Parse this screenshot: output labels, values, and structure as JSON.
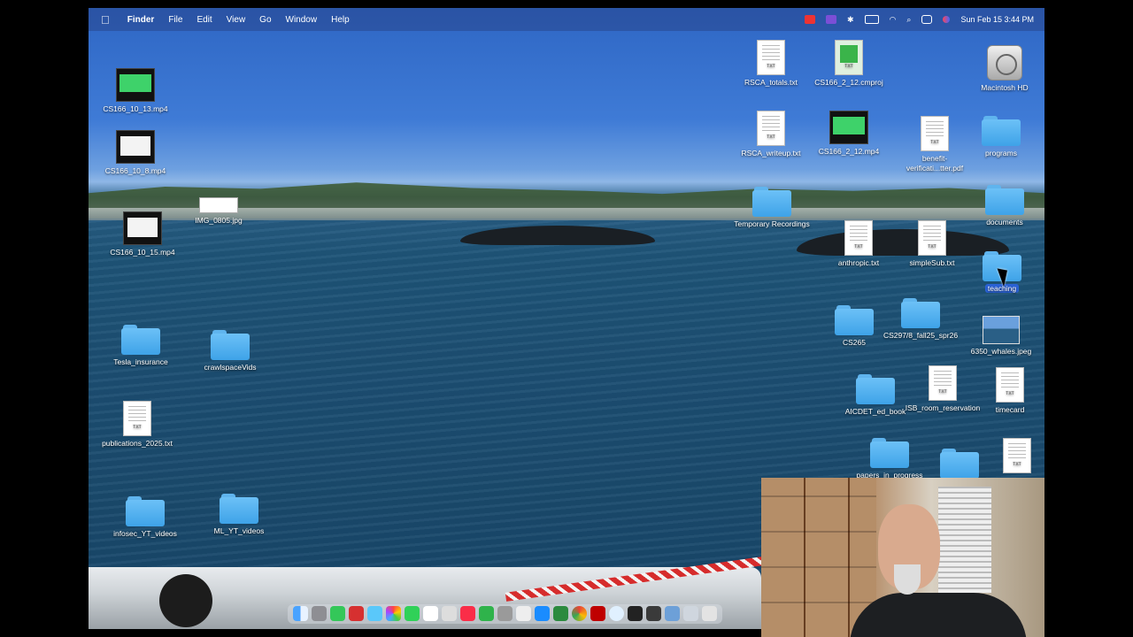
{
  "menubar": {
    "app": "Finder",
    "items": [
      "File",
      "Edit",
      "View",
      "Go",
      "Window",
      "Help"
    ],
    "clock": "Sun Feb 15  3:44 PM"
  },
  "desktop": {
    "items": [
      {
        "label": "CS166_10_13.mp4",
        "kind": "video-thumb"
      },
      {
        "label": "CS166_10_8.mp4",
        "kind": "video-thumb"
      },
      {
        "label": "IMG_0805.jpg",
        "kind": "image"
      },
      {
        "label": "CS166_10_15.mp4",
        "kind": "video-thumb"
      },
      {
        "label": "Tesla_insurance",
        "kind": "folder"
      },
      {
        "label": "crawlspaceVids",
        "kind": "folder"
      },
      {
        "label": "publications_2025.txt",
        "kind": "text"
      },
      {
        "label": "infosec_YT_videos",
        "kind": "folder"
      },
      {
        "label": "ML_YT_videos",
        "kind": "folder"
      },
      {
        "label": "RSCA_totals.txt",
        "kind": "text"
      },
      {
        "label": "CS166_2_12.cmproj",
        "kind": "project"
      },
      {
        "label": "Macintosh HD",
        "kind": "drive"
      },
      {
        "label": "RSCA_writeup.txt",
        "kind": "text"
      },
      {
        "label": "CS166_2_12.mp4",
        "kind": "video-thumb"
      },
      {
        "label": "benefit-verificati...tter.pdf",
        "kind": "pdf"
      },
      {
        "label": "programs",
        "kind": "folder"
      },
      {
        "label": "Temporary Recordings",
        "kind": "folder"
      },
      {
        "label": "documents",
        "kind": "folder"
      },
      {
        "label": "anthropic.txt",
        "kind": "text"
      },
      {
        "label": "simpleSub.txt",
        "kind": "text"
      },
      {
        "label": "teaching",
        "kind": "folder"
      },
      {
        "label": "CS265",
        "kind": "folder"
      },
      {
        "label": "CS297/8_fall25_spr26",
        "kind": "folder"
      },
      {
        "label": "6350_whales.jpeg",
        "kind": "image"
      },
      {
        "label": "AICDET_ed_book",
        "kind": "folder"
      },
      {
        "label": "ISB_room_reservation",
        "kind": "text"
      },
      {
        "label": "timecard",
        "kind": "text"
      },
      {
        "label": "papers_in_progress",
        "kind": "folder"
      }
    ]
  },
  "icons": {
    "apple": "apple-icon",
    "wifi": "wifi-icon",
    "search": "search-icon",
    "bluetooth": "bluetooth-icon"
  },
  "colors": {
    "folder": "#4fb0ef",
    "selection": "#2a62d6"
  }
}
